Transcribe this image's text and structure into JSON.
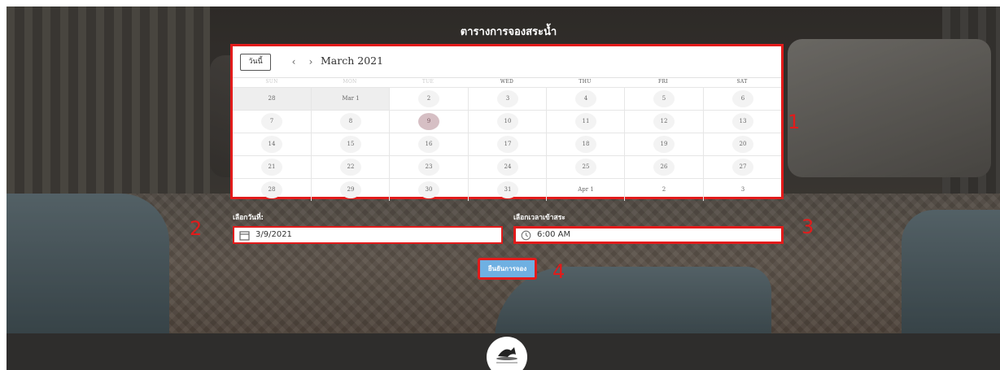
{
  "header": {
    "title": "ตารางการจองสระน้ำ"
  },
  "calendar": {
    "today_label": "วันนี้",
    "prev_symbol": "‹",
    "next_symbol": "›",
    "month_label": "March 2021",
    "weekdays": [
      "SUN",
      "MON",
      "TUE",
      "WED",
      "THU",
      "FRI",
      "SAT"
    ],
    "weeks": [
      [
        "28",
        "Mar 1",
        "2",
        "3",
        "4",
        "5",
        "6"
      ],
      [
        "7",
        "8",
        "9",
        "10",
        "11",
        "12",
        "13"
      ],
      [
        "14",
        "15",
        "16",
        "17",
        "18",
        "19",
        "20"
      ],
      [
        "21",
        "22",
        "23",
        "24",
        "25",
        "26",
        "27"
      ],
      [
        "28",
        "29",
        "30",
        "31",
        "Apr 1",
        "2",
        "3"
      ]
    ],
    "selected_day": "9"
  },
  "form": {
    "date_label": "เลือกวันที่:",
    "date_value": "3/9/2021",
    "time_label": "เลือกเวลาเข้าสระ",
    "time_value": "6:00 AM",
    "submit_label": "ยืนยันการจอง"
  },
  "annotations": [
    "1",
    "2",
    "3",
    "4"
  ],
  "colors": {
    "annotation_red": "#e21b1b",
    "button_blue": "#6fb0e2",
    "selected_day_bg": "#d6bfc4",
    "footer_bg": "#2e2d2c"
  },
  "icons": {
    "calendar_field": "calendar-icon",
    "time_field": "clock-icon",
    "logo": "logo-icon"
  }
}
